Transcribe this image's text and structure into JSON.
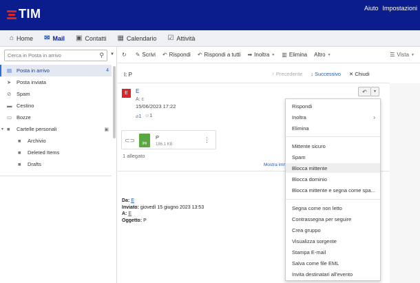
{
  "header": {
    "brand": "TIM",
    "links": [
      "Aiuto",
      "Impostazioni"
    ]
  },
  "nav": {
    "tabs": [
      {
        "label": "Home",
        "icon": "home-icon"
      },
      {
        "label": "Mail",
        "icon": "mail-icon"
      },
      {
        "label": "Contatti",
        "icon": "contacts-icon"
      },
      {
        "label": "Calendario",
        "icon": "calendar-icon"
      },
      {
        "label": "Attività",
        "icon": "tasks-icon"
      }
    ],
    "active_tab": "Mail"
  },
  "sidebar": {
    "search_placeholder": "Cerca in Posta in arrivo",
    "folders": [
      {
        "label": "Posta in arrivo",
        "count": "4"
      },
      {
        "label": "Posta inviata"
      },
      {
        "label": "Spam"
      },
      {
        "label": "Cestino"
      },
      {
        "label": "Bozze"
      },
      {
        "label": "Cartelle personali"
      },
      {
        "label": "Archivio"
      },
      {
        "label": "Deleted Items"
      },
      {
        "label": "Drafts"
      }
    ]
  },
  "toolbar": {
    "buttons": [
      "Scrivi",
      "Rispondi",
      "Rispondi a tutti",
      "Inoltra",
      "Elimina",
      "Altro"
    ],
    "view": "Vista"
  },
  "message": {
    "subject": "I: P",
    "nav_prev": "Precedente",
    "nav_next": "Successivo",
    "nav_close": "Chiudi",
    "avatar_letter": "E",
    "sender": "E",
    "recipients": "A: c",
    "date": "15/06/2023 17:22",
    "attach_badge": "1",
    "people_badge": "1",
    "attachment": {
      "name": "P",
      "size": "186.1 KB",
      "type_label": "jpg"
    },
    "attach_count": "1 allegato",
    "show_link": "Mostra imm",
    "quoted": {
      "from_label": "Da:",
      "from_value": "E",
      "sent_label": "Inviato:",
      "sent_value": "giovedì 15 giugno 2023 13:53",
      "to_label": "A:",
      "to_value": "E",
      "subject_label": "Oggetto:",
      "subject_value": "P"
    }
  },
  "context_menu": {
    "items": [
      "Rispondi",
      "Inoltra",
      "Elimina",
      "Mittente sicuro",
      "Spam",
      "Blocca mittente",
      "Blocca dominio",
      "Blocca mittente e segna come spa...",
      "Segna come non letto",
      "Contrassegna per seguire",
      "Crea gruppo",
      "Visualizza sorgente",
      "Stampa E-mail",
      "Salva come file EML",
      "Invita destinatari all'evento"
    ],
    "hovered": "Blocca mittente"
  }
}
